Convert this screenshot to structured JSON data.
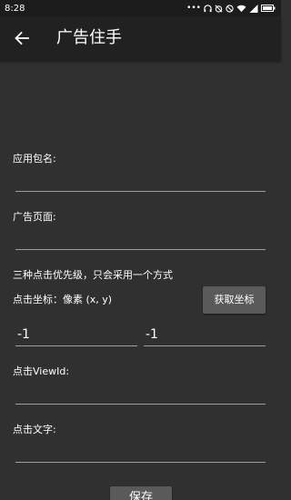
{
  "status_bar": {
    "time": "8:28",
    "dots": "•••",
    "battery_icon": "battery-icon",
    "wifi_icon": "wifi-icon",
    "signal_icon": "signal-icon"
  },
  "toolbar": {
    "back_icon": "arrow-back-icon",
    "title": "广告住手"
  },
  "form": {
    "package_label": "应用包名:",
    "package_value": "",
    "page_label": "广告页面:",
    "page_value": "",
    "priority_note": "三种点击优先级，只会采用一个方式",
    "coord_label": "点击坐标：像素 (x, y)",
    "get_coord_button": "获取坐标",
    "x_value": "-1",
    "y_value": "-1",
    "viewid_label": "点击ViewId:",
    "viewid_value": "",
    "text_label": "点击文字:",
    "text_value": "",
    "save_button": "保存"
  },
  "colors": {
    "background": "#303030",
    "toolbar": "#212121",
    "status_bar": "#1c1c1c",
    "button": "#5a5a5a",
    "underline": "#9e9e9e"
  }
}
